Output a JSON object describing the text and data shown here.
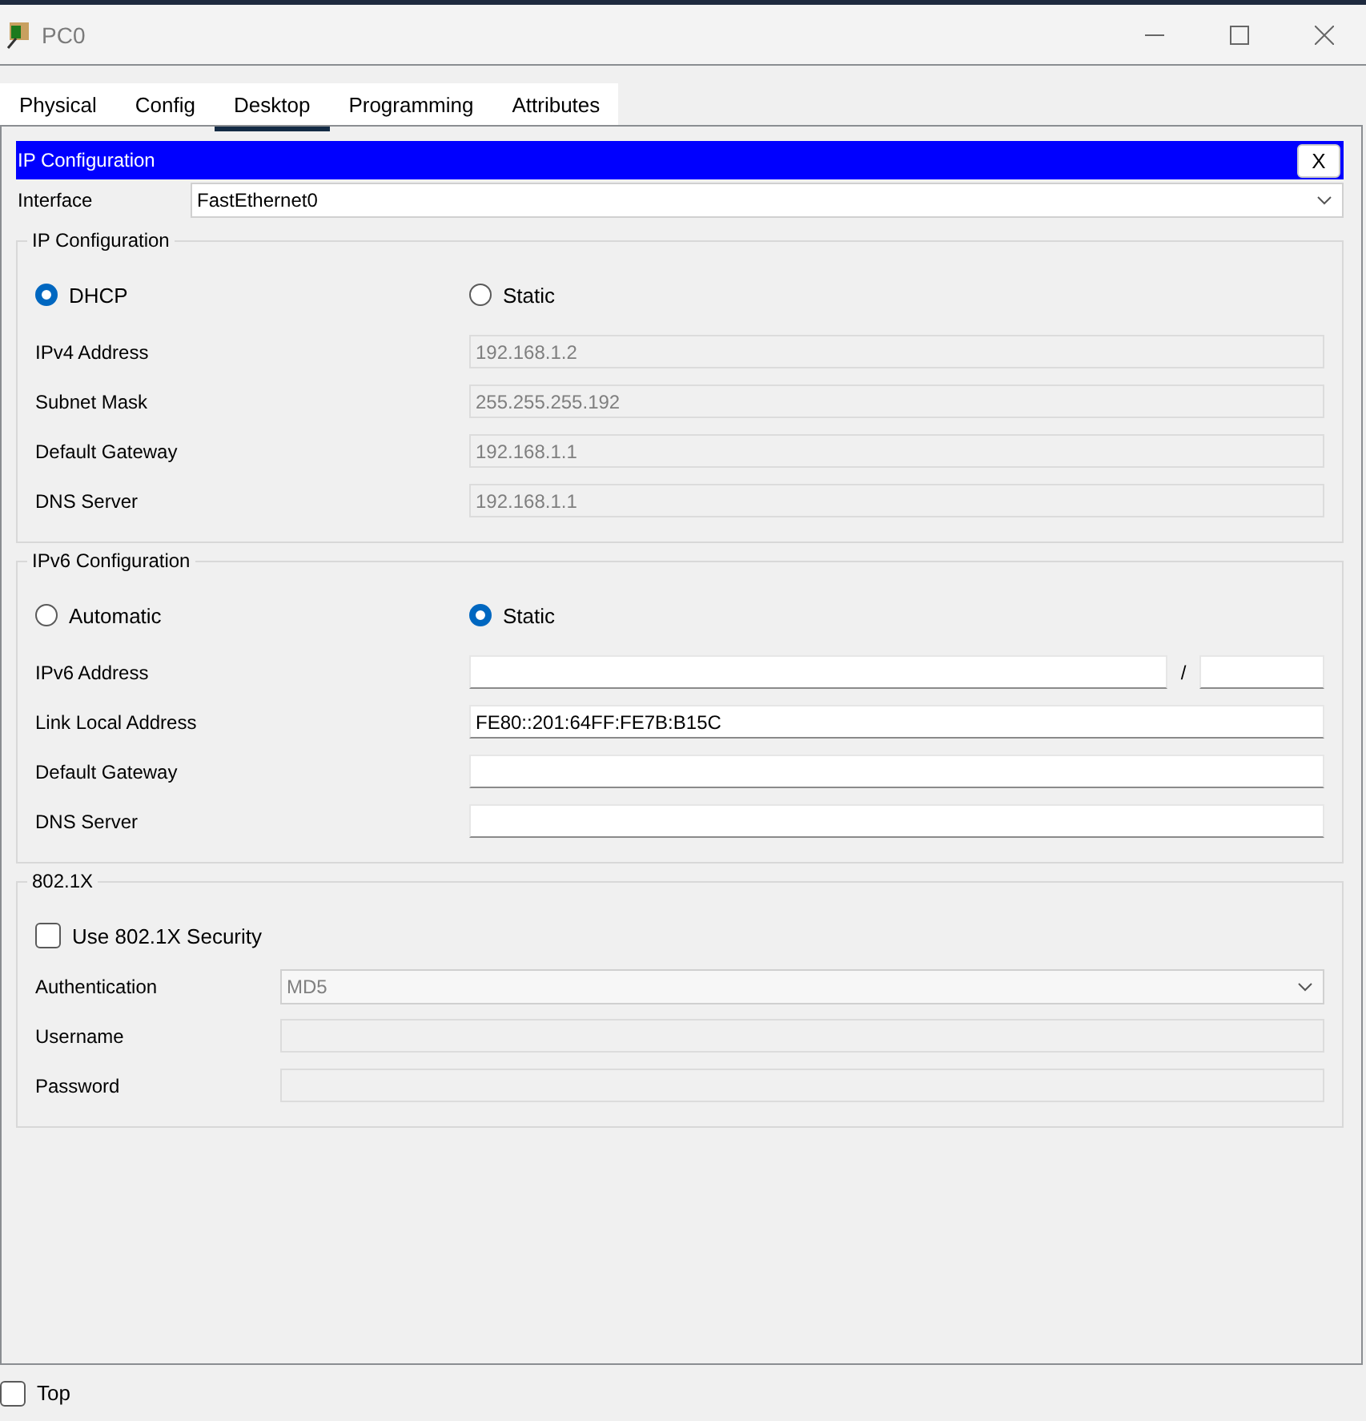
{
  "window": {
    "title": "PC0"
  },
  "tabs": [
    {
      "label": "Physical",
      "selected": false
    },
    {
      "label": "Config",
      "selected": false
    },
    {
      "label": "Desktop",
      "selected": true
    },
    {
      "label": "Programming",
      "selected": false
    },
    {
      "label": "Attributes",
      "selected": false
    }
  ],
  "panel": {
    "title": "IP Configuration",
    "close": "X",
    "interface": {
      "label": "Interface",
      "value": "FastEthernet0"
    },
    "groups": [
      {
        "legend": "IP Configuration",
        "modes": [
          {
            "label": "DHCP",
            "selected": true
          },
          {
            "label": "Static",
            "selected": false
          }
        ],
        "fields": [
          {
            "kind": "text",
            "label": "IPv4 Address",
            "value": "192.168.1.2",
            "disabled": true
          },
          {
            "kind": "text",
            "label": "Subnet Mask",
            "value": "255.255.255.192",
            "disabled": true
          },
          {
            "kind": "text",
            "label": "Default Gateway",
            "value": "192.168.1.1",
            "disabled": true
          },
          {
            "kind": "text",
            "label": "DNS Server",
            "value": "192.168.1.1",
            "disabled": true
          }
        ]
      },
      {
        "legend": "IPv6 Configuration",
        "modes": [
          {
            "label": "Automatic",
            "selected": false
          },
          {
            "label": "Static",
            "selected": true
          }
        ],
        "fields": [
          {
            "kind": "prefix",
            "label": "IPv6 Address",
            "separator": "/",
            "disabled": false
          },
          {
            "kind": "text",
            "label": "Link Local Address",
            "value": "FE80::201:64FF:FE7B:B15C",
            "disabled": false
          },
          {
            "kind": "text",
            "label": "Default Gateway",
            "disabled": false
          },
          {
            "kind": "text",
            "label": "DNS Server",
            "disabled": false
          }
        ]
      },
      {
        "legend": "802.1X",
        "check": {
          "label": "Use 802.1X Security",
          "checked": false
        },
        "fields": [
          {
            "kind": "select",
            "label": "Authentication",
            "value": "MD5",
            "disabled": true
          },
          {
            "kind": "text",
            "label": "Username",
            "disabled": true
          },
          {
            "kind": "text",
            "label": "Password",
            "disabled": true
          }
        ]
      }
    ]
  },
  "footer": {
    "label": "Top",
    "checked": false
  }
}
